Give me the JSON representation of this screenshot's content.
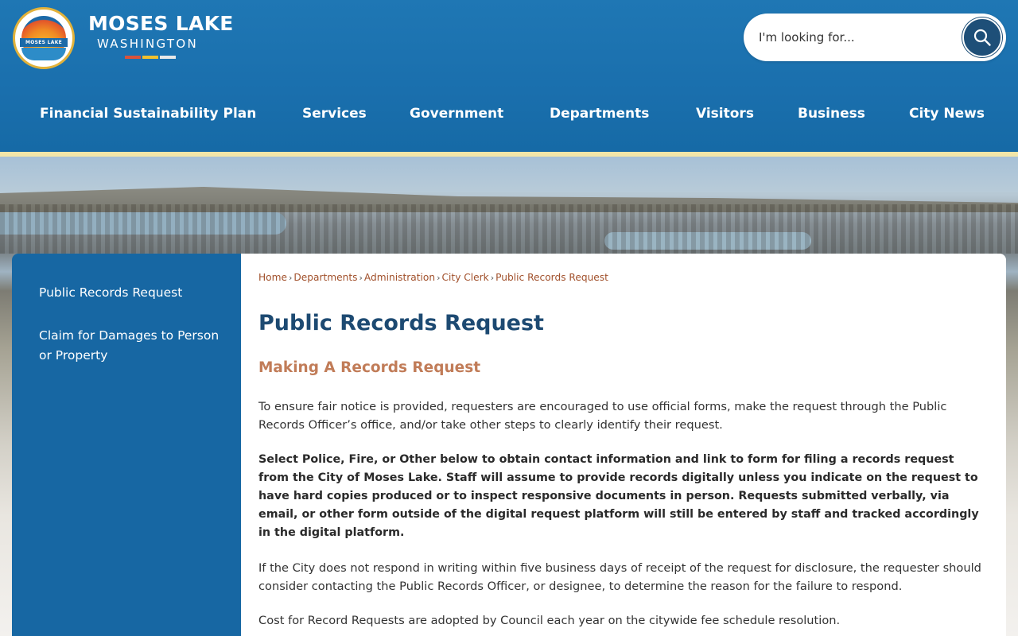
{
  "header": {
    "logo": {
      "badge_text": "MOSES LAKE"
    },
    "brand_title": "MOSES LAKE",
    "brand_subtitle": "WASHINGTON",
    "brand_stripe_colors": [
      "#d9533b",
      "#f2c12e",
      "#e8e8e8",
      "#5aa6d8"
    ],
    "search": {
      "placeholder": "I'm looking for...",
      "icon": "search-icon"
    },
    "nav": [
      {
        "label": "Financial Sustainability Plan"
      },
      {
        "label": "Services"
      },
      {
        "label": "Government"
      },
      {
        "label": "Departments"
      },
      {
        "label": "Visitors"
      },
      {
        "label": "Business"
      },
      {
        "label": "City News"
      }
    ]
  },
  "sidebar": {
    "items": [
      {
        "label": "Public Records Request"
      },
      {
        "label": "Claim for Damages to Person or Property"
      }
    ]
  },
  "breadcrumb": [
    {
      "label": "Home"
    },
    {
      "label": "Departments"
    },
    {
      "label": "Administration"
    },
    {
      "label": "City Clerk"
    },
    {
      "label": "Public Records Request"
    }
  ],
  "main": {
    "title": "Public Records Request",
    "section_title": "Making A Records Request",
    "paragraphs": [
      "To ensure fair notice is provided, requesters are encouraged to use official forms, make the request through the Public Records Officer’s office, and/or take other steps to clearly identify their request.",
      "Select Police, Fire, or Other below to obtain contact information and link to form for filing a records request from the City of Moses Lake. Staff will assume to provide records digitally unless you indicate on the request to have hard copies produced or to inspect responsive documents in person. Requests submitted verbally, via email, or other form outside of the digital request platform will still be entered by staff and tracked accordingly in the digital platform.",
      "If the City does not respond in writing within five business days of receipt of the request for disclosure, the requester should consider contacting the Public Records Officer, or designee, to determine the reason for the failure to respond.",
      "Cost for Record Requests are adopted by Council each year on the citywide fee schedule resolution."
    ]
  },
  "colors": {
    "header_blue": "#1a6fad",
    "sidebar_blue": "#1767a3",
    "title_navy": "#1d4a72",
    "section_accent": "#c17c58",
    "link_rust": "#a1502b",
    "gold_rule": "#f2e6a8"
  }
}
